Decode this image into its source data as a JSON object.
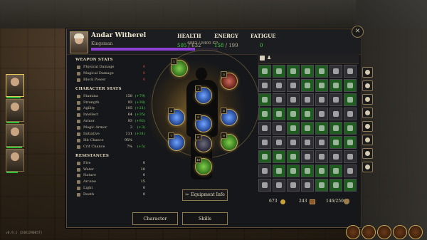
{
  "header": {
    "name": "Andar Witherel",
    "class": "Kingsman",
    "xp": "6882 / 8400 XP",
    "xp_fraction": 0.819,
    "health_label": "HEALTH",
    "health_current": "505",
    "health_max": "632",
    "energy_label": "ENERGY",
    "energy_current": "158",
    "energy_max": "199",
    "fatigue_label": "FATIGUE",
    "fatigue_value": "0"
  },
  "weapon_stats": {
    "title": "WEAPON STATS",
    "rows": [
      {
        "label": "Physical Damage",
        "value": "0"
      },
      {
        "label": "Magical Damage",
        "value": "0"
      },
      {
        "label": "Block Power",
        "value": "0"
      }
    ]
  },
  "character_stats": {
    "title": "CHARACTER STATS",
    "rows": [
      {
        "label": "Stamina",
        "value": "158",
        "bonus": "(+79)"
      },
      {
        "label": "Strength",
        "value": "93",
        "bonus": "(+38)"
      },
      {
        "label": "Agility",
        "value": "105",
        "bonus": "(+21)"
      },
      {
        "label": "Intellect",
        "value": "64",
        "bonus": "(+35)"
      },
      {
        "label": "Armor",
        "value": "93",
        "bonus": "(+92)"
      },
      {
        "label": "Magic Armor",
        "value": "3",
        "bonus": "(+3)"
      },
      {
        "label": "Initiative",
        "value": "111",
        "bonus": "(+31)"
      },
      {
        "label": "Hit Chance",
        "value": "95%",
        "bonus": ""
      },
      {
        "label": "Crit Chance",
        "value": "7%",
        "bonus": "(+5)"
      }
    ]
  },
  "resistances": {
    "title": "RESISTANCES",
    "rows": [
      {
        "label": "Fire",
        "value": "0"
      },
      {
        "label": "Water",
        "value": "10"
      },
      {
        "label": "Nature",
        "value": "0"
      },
      {
        "label": "Arcane",
        "value": "15"
      },
      {
        "label": "Light",
        "value": "0"
      },
      {
        "label": "Death",
        "value": "0"
      }
    ]
  },
  "equipment_info_label": "Equipment Info",
  "buttons": {
    "character": "Character",
    "skills": "Skills"
  },
  "inventory": {
    "gold": "673",
    "chest_count": "243",
    "capacity": "146/250"
  },
  "version": "v0.9.1 (2401290057)",
  "colors": {
    "health_value": "#4fd84a",
    "energy_value": "#4fd84a",
    "xp_bar": "#8e3fd4",
    "bonus_green": "#4fd84a",
    "frame_gold": "#c8a858"
  },
  "icons": {
    "close": "close-icon",
    "equip_info": "scissors-icon",
    "inventory_filter": "square-filter-icon",
    "inventory_person": "person-icon"
  }
}
